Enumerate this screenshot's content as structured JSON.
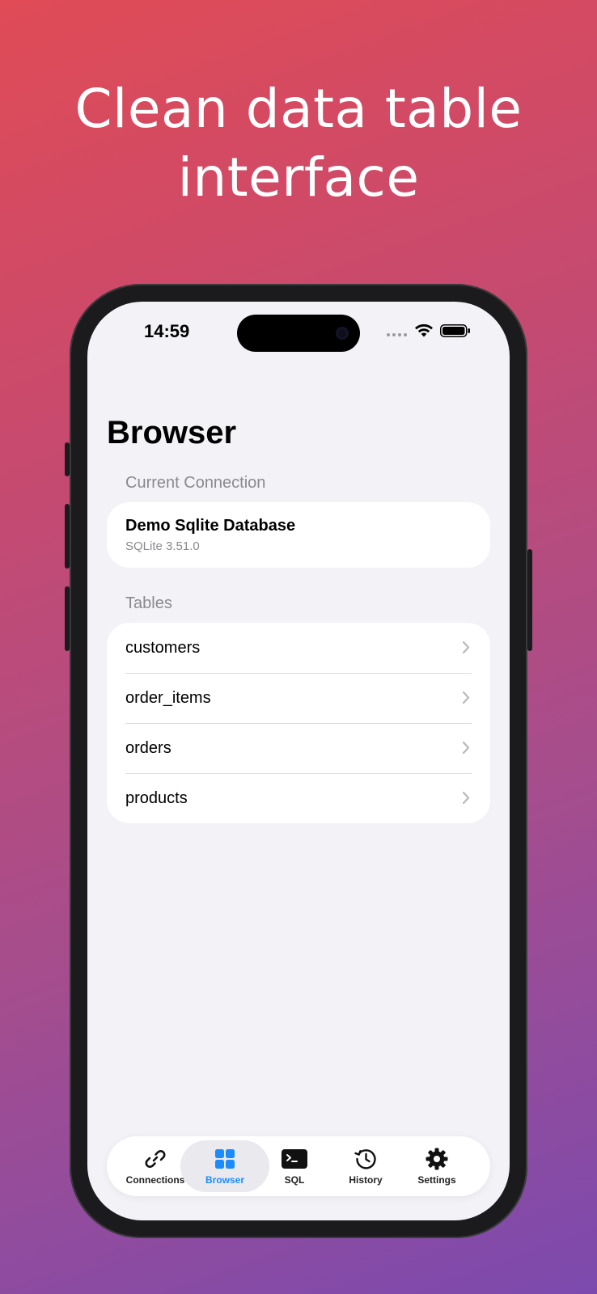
{
  "headline": "Clean data table interface",
  "status_bar": {
    "time": "14:59"
  },
  "page": {
    "title": "Browser"
  },
  "current_connection": {
    "header": "Current Connection",
    "name": "Demo Sqlite Database",
    "subtitle": "SQLite 3.51.0"
  },
  "tables": {
    "header": "Tables",
    "items": [
      {
        "label": "customers"
      },
      {
        "label": "order_items"
      },
      {
        "label": "orders"
      },
      {
        "label": "products"
      }
    ]
  },
  "tab_bar": {
    "active": "Browser",
    "tabs": [
      {
        "label": "Connections",
        "icon": "link-icon"
      },
      {
        "label": "Browser",
        "icon": "grid-icon"
      },
      {
        "label": "SQL",
        "icon": "terminal-icon"
      },
      {
        "label": "History",
        "icon": "history-icon"
      },
      {
        "label": "Settings",
        "icon": "gear-icon"
      }
    ]
  },
  "colors": {
    "accent": "#1a8cff",
    "background": "#f2f2f7",
    "secondary_text": "#8a8a8e"
  }
}
